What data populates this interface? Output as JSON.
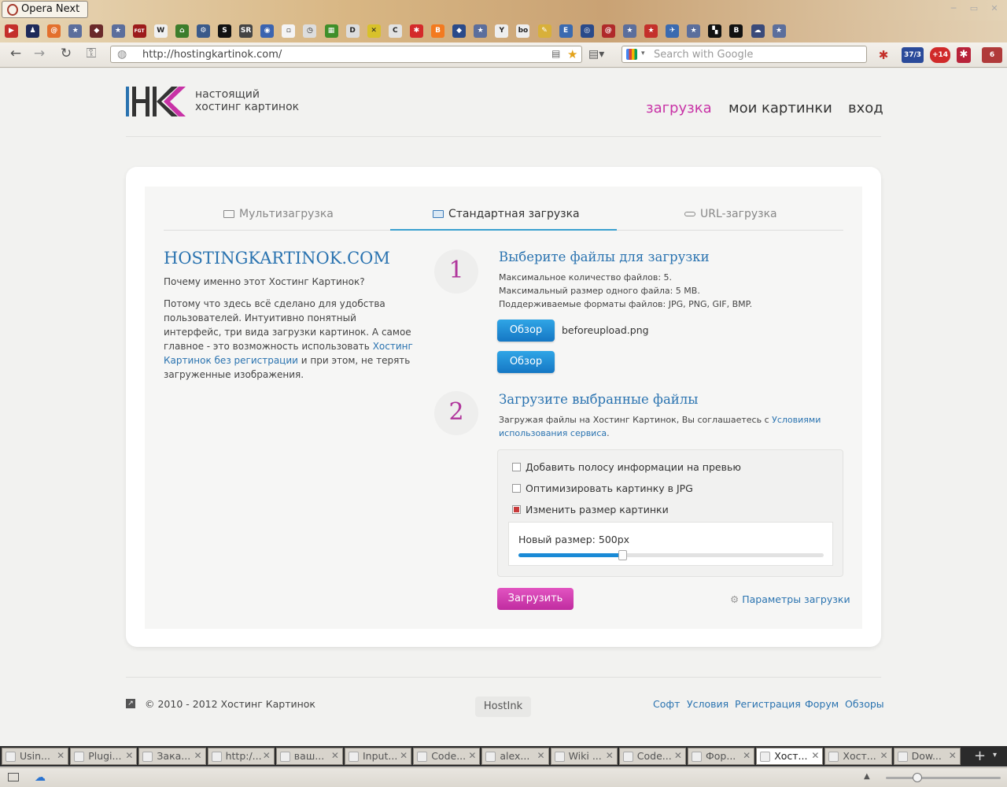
{
  "browser": {
    "app_name": "Opera Next",
    "url": "http://hostingkartinok.com/",
    "search_placeholder": "Search with Google",
    "badge_mail": "37/3",
    "badge_plus": "+14",
    "badge_count": "6"
  },
  "bookmarks": [
    {
      "name": "youtube",
      "color": "#c4302b",
      "glyph": "▶"
    },
    {
      "name": "person",
      "color": "#1e2a5a",
      "glyph": "♟"
    },
    {
      "name": "at",
      "color": "#e3702d",
      "glyph": "@"
    },
    {
      "name": "star",
      "color": "#5b6e9c",
      "glyph": "★"
    },
    {
      "name": "shield",
      "color": "#6a2a2a",
      "glyph": "◆"
    },
    {
      "name": "star",
      "color": "#5b6e9c",
      "glyph": "★"
    },
    {
      "name": "fgt",
      "color": "#9c1b1b",
      "glyph": "FGT"
    },
    {
      "name": "wiki",
      "color": "#f0f0f0",
      "glyph": "W"
    },
    {
      "name": "home",
      "color": "#3c7d2c",
      "glyph": "⌂"
    },
    {
      "name": "gear",
      "color": "#3a5a8a",
      "glyph": "⚙"
    },
    {
      "name": "s",
      "color": "#111",
      "glyph": "S"
    },
    {
      "name": "sr",
      "color": "#444",
      "glyph": "SR"
    },
    {
      "name": "circle",
      "color": "#3b64b0",
      "glyph": "◉"
    },
    {
      "name": "doc",
      "color": "#f4f4f4",
      "glyph": "▫"
    },
    {
      "name": "clock",
      "color": "#ddd",
      "glyph": "◷"
    },
    {
      "name": "green",
      "color": "#3f8f2a",
      "glyph": "▦"
    },
    {
      "name": "d",
      "color": "#ddd",
      "glyph": "D"
    },
    {
      "name": "x",
      "color": "#d8c12a",
      "glyph": "✕"
    },
    {
      "name": "c",
      "color": "#e2e2e2",
      "glyph": "C"
    },
    {
      "name": "bug",
      "color": "#d42a2a",
      "glyph": "✱"
    },
    {
      "name": "blogger",
      "color": "#f37a1f",
      "glyph": "B"
    },
    {
      "name": "shield",
      "color": "#2a4a8a",
      "glyph": "◆"
    },
    {
      "name": "star",
      "color": "#5b6e9c",
      "glyph": "★"
    },
    {
      "name": "y",
      "color": "#eee",
      "glyph": "Y"
    },
    {
      "name": "bo",
      "color": "#eee",
      "glyph": "bo"
    },
    {
      "name": "pen",
      "color": "#d8b03a",
      "glyph": "✎"
    },
    {
      "name": "e",
      "color": "#3a6ab0",
      "glyph": "E"
    },
    {
      "name": "globe",
      "color": "#2a4a8a",
      "glyph": "◎"
    },
    {
      "name": "swirl",
      "color": "#b02a2a",
      "glyph": "@"
    },
    {
      "name": "star",
      "color": "#5b6e9c",
      "glyph": "★"
    },
    {
      "name": "star",
      "color": "#c4302b",
      "glyph": "★"
    },
    {
      "name": "plane",
      "color": "#3a6ab0",
      "glyph": "✈"
    },
    {
      "name": "star",
      "color": "#5b6e9c",
      "glyph": "★"
    },
    {
      "name": "check",
      "color": "#111",
      "glyph": "▚"
    },
    {
      "name": "b",
      "color": "#111",
      "glyph": "B"
    },
    {
      "name": "cloud",
      "color": "#3a4a7a",
      "glyph": "☁"
    },
    {
      "name": "star",
      "color": "#5b6e9c",
      "glyph": "★"
    }
  ],
  "site": {
    "logo_tagline_1": "настоящий",
    "logo_tagline_2": "хостинг картинок",
    "nav": {
      "upload": "загрузка",
      "my_images": "мои картинки",
      "login": "вход"
    },
    "tabs": {
      "multi": "Мультизагрузка",
      "standard": "Стандартная загрузка",
      "url": "URL-загрузка"
    },
    "left": {
      "title": "HOSTINGKARTINOK.COM",
      "why": "Почему именно этот Хостинг Картинок?",
      "desc_1": "Потому что здесь всё сделано для удобства пользователей. Интуитивно понятный интерфейс, три вида загрузки картинок. А самое главное - это возможность использовать ",
      "desc_link": "Хостинг Картинок без регистрации",
      "desc_2": " и при этом, не терять загруженные изображения."
    },
    "step1": {
      "num": "1",
      "title": "Выберите файлы для загрузки",
      "max_files": "Максимальное количество файлов: 5.",
      "max_size": "Максимальный размер одного файла: 5 MB.",
      "formats": "Поддерживаемые форматы файлов: JPG, PNG, GIF, BMP.",
      "browse_label": "Обзор",
      "filename": "beforeupload.png"
    },
    "step2": {
      "num": "2",
      "title": "Загрузите выбранные файлы",
      "terms_text": "Загружая файлы на Хостинг Картинок, Вы соглашаетесь с ",
      "terms_link": "Условиями использования сервиса",
      "terms_end": "."
    },
    "options": {
      "info_bar": "Добавить полосу информации на превью",
      "optimize": "Оптимизировать картинку в JPG",
      "resize": "Изменить размер картинки",
      "info_bar_checked": false,
      "optimize_checked": false,
      "resize_checked": true,
      "new_size_label": "Новый размер:",
      "new_size_value": "500px",
      "slider_fraction": 0.34
    },
    "submit_label": "Загрузить",
    "params_label": "Параметры загрузки",
    "footer": {
      "copyright": "© 2010 - 2012 Хостинг Картинок",
      "hostink": "HostInk",
      "links": [
        "Софт",
        "Условия",
        "Регистрация",
        "Форум",
        "Обзоры"
      ]
    }
  },
  "browser_tabs": [
    {
      "label": "Usin...",
      "active": false
    },
    {
      "label": "Plugi...",
      "active": false
    },
    {
      "label": "Зака...",
      "active": false
    },
    {
      "label": "http:/...",
      "active": false
    },
    {
      "label": "ваш...",
      "active": false
    },
    {
      "label": "Input...",
      "active": false
    },
    {
      "label": "Code...",
      "active": false
    },
    {
      "label": "alex...",
      "active": false
    },
    {
      "label": "Wiki ...",
      "active": false
    },
    {
      "label": "Code...",
      "active": false
    },
    {
      "label": "Фор...",
      "active": false
    },
    {
      "label": "Хост...",
      "active": true
    },
    {
      "label": "Хост...",
      "active": false
    },
    {
      "label": "Dow...",
      "active": false
    }
  ],
  "colors": {
    "accent_pink": "#c832a6",
    "accent_blue": "#2a73b0",
    "button_blue": "#1a8ad6"
  }
}
